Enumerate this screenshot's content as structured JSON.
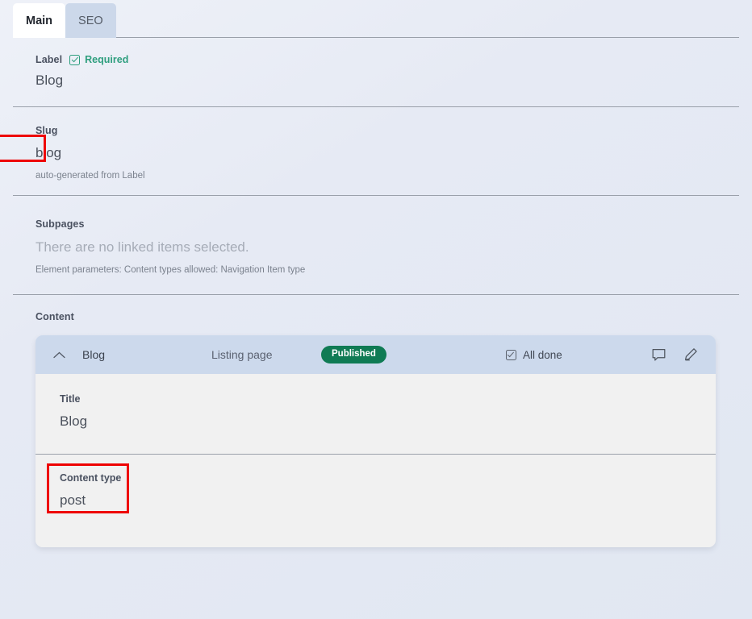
{
  "tabs": [
    {
      "label": "Main",
      "active": true
    },
    {
      "label": "SEO",
      "active": false
    }
  ],
  "fields": {
    "label": {
      "name": "Label",
      "required_text": "Required",
      "value": "Blog"
    },
    "slug": {
      "name": "Slug",
      "value": "blog",
      "hint": "auto-generated from Label"
    },
    "subpages": {
      "name": "Subpages",
      "empty_text": "There are no linked items selected.",
      "hint": "Element parameters: Content types allowed: Navigation Item type"
    },
    "content": {
      "name": "Content"
    }
  },
  "content_card": {
    "title": "Blog",
    "subtitle": "Listing page",
    "status_badge": "Published",
    "all_done_label": "All done",
    "icons": {
      "collapse": "chevron-up-icon",
      "comment": "comment-icon",
      "edit": "pencil-icon"
    },
    "fields": [
      {
        "label": "Title",
        "value": "Blog"
      },
      {
        "label": "Content type",
        "value": "post"
      }
    ]
  },
  "colors": {
    "accent_green": "#2e9e7e",
    "badge_green": "#0f7b54",
    "highlight_red": "#ee0000",
    "tab_active_bg": "#ffffff",
    "tab_inactive_bg": "#ccd8ea",
    "card_head_bg": "#ccd9ec",
    "card_body_bg": "#f1f1f1",
    "page_bg": "#e4e9f2"
  }
}
